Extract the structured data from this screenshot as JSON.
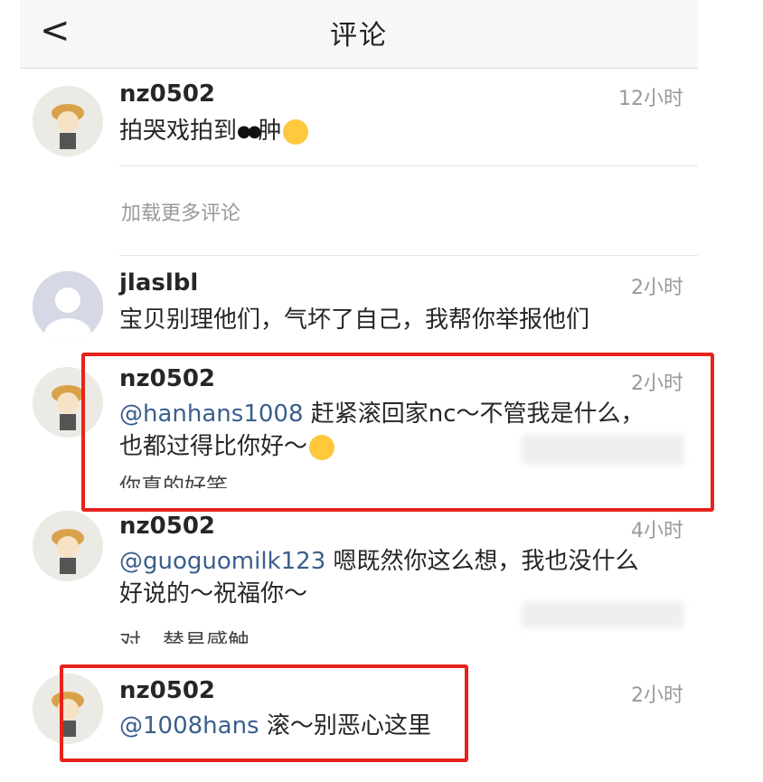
{
  "nav": {
    "back_glyph": "<",
    "title": "评论"
  },
  "load_more": "加载更多评论",
  "comments": [
    {
      "user": "nz0502",
      "time": "12小时",
      "text": "拍哭戏拍到",
      "text_tail": "肿"
    },
    {
      "user": "jlaslbl",
      "time": "2小时",
      "text": "宝贝别理他们，气坏了自己，我帮你举报他们"
    },
    {
      "user": "nz0502",
      "time": "2小时",
      "mention": "@hanhans1008",
      "text": " 赶紧滚回家nc～不管我是什么，",
      "text2": "也都过得比你好～"
    },
    {
      "user": "nz0502",
      "time": "4小时",
      "mention": "@guoguomilk123",
      "text": " 嗯既然你这么想，我也没什么",
      "text2": "好说的～祝福你～"
    },
    {
      "user": "nz0502",
      "time": "2小时",
      "mention": "@1008hans",
      "text": " 滚～别恶心这里"
    }
  ],
  "partial_texts": {
    "first": "你真的好笑",
    "second": "对，替易感触"
  },
  "colors": {
    "highlight": "#e8231b",
    "mention": "#3b5f8c",
    "time": "#999999"
  },
  "icons": [
    "back-chevron-icon",
    "avatar-cartoon-icon",
    "avatar-default-icon",
    "sad-emoji-icon",
    "smile-emoji-icon",
    "eyes-emoji-icon"
  ]
}
